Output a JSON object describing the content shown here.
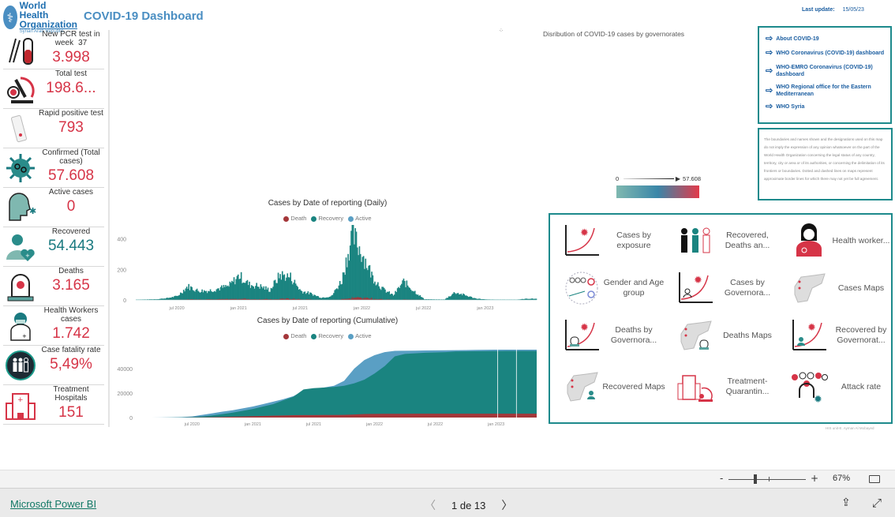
{
  "header": {
    "org_line1": "World Health",
    "org_line2": "Organization",
    "org_line3": "Syrian Arab Republic",
    "title": "COVID-19 Dashboard",
    "last_update_label": "Last update:",
    "last_update_value": "15/05/23"
  },
  "kpis": [
    {
      "label": "New PCR test in week",
      "sub": "37",
      "value": "3.998",
      "icon": "pcr-test-tube-icon",
      "color": "#d63447"
    },
    {
      "label": "Total test",
      "value": "198.6...",
      "icon": "microscope-icon",
      "color": "#d63447"
    },
    {
      "label": "Rapid positive test",
      "value": "793",
      "icon": "rapid-test-icon",
      "color": "#d63447"
    },
    {
      "label": "Confirmed (Total cases)",
      "value": "57.608",
      "icon": "virus-icon",
      "color": "#d63447"
    },
    {
      "label": "Active cases",
      "value": "0",
      "icon": "patient-head-icon",
      "color": "#d63447"
    },
    {
      "label": "Recovered",
      "value": "54.443",
      "icon": "recovered-person-heart-icon",
      "color": "#1a7a80"
    },
    {
      "label": "Deaths",
      "value": "3.165",
      "icon": "gravestone-icon",
      "color": "#d63447"
    },
    {
      "label": "Health Workers cases",
      "value": "1.742",
      "icon": "health-worker-icon",
      "color": "#d63447"
    },
    {
      "label": "Case fatality rate",
      "value": "5,49%",
      "icon": "people-circle-icon",
      "color": "#d63447"
    },
    {
      "label": "Treatment Hospitals",
      "value": "151",
      "icon": "hospital-icon",
      "color": "#d63447"
    }
  ],
  "map": {
    "title": "Disribution of COVID-19 cases by governorates",
    "scale_min": "0",
    "scale_max": "57.608",
    "gradient_colors": [
      "#7fb8b0",
      "#3a86a8",
      "#e23a4a"
    ]
  },
  "links": [
    "About COVID-19",
    "WHO Coronavirus (COVID-19) dashboard",
    "WHO-EMRO Coronavirus (COVID-19) dashboard",
    "WHO Regional office for the Eastern Mediterranean",
    "WHO Syria"
  ],
  "disclaimer": "The boundaries and names shown and the designations used on this map do not imply the expression of any opinion whatsoever on the part of the World Health Organization concerning the legal status of any country, territory, city or area or of its authorities, or concerning the delimitation of its frontiers or boundaries. Dotted and dashed lines on maps represent approximate border lines for which there may not yet be full agreement.",
  "nav_items": [
    {
      "label": "Cases by exposure",
      "icon": "chart-virus-icon"
    },
    {
      "label": "Recovered, Deaths an...",
      "icon": "three-people-icon"
    },
    {
      "label": "Health worker...",
      "icon": "doctor-woman-icon"
    },
    {
      "label": "Gender and Age group",
      "icon": "gender-age-icon"
    },
    {
      "label": "Cases by Governora...",
      "icon": "chart-person-virus-icon"
    },
    {
      "label": "Cases Maps",
      "icon": "syria-map-icon"
    },
    {
      "label": "Deaths by Governora...",
      "icon": "chart-gravestone-icon"
    },
    {
      "label": "Deaths Maps",
      "icon": "map-gravestone-icon"
    },
    {
      "label": "Recovered by Governorat...",
      "icon": "chart-recovered-icon"
    },
    {
      "label": "Recovered Maps",
      "icon": "map-recovered-icon"
    },
    {
      "label": "Treatment-Quarantin...",
      "icon": "hospital-microscope-icon"
    },
    {
      "label": "Attack rate",
      "icon": "people-virus-icon"
    }
  ],
  "credits": "HIS unit-E. Ayman Al Mobayed",
  "footer": {
    "zoom_minus": "-",
    "zoom_plus": "+",
    "zoom_level": "67%",
    "zoom_fraction": 0.35,
    "brand_link": "Microsoft Power BI",
    "page_indicator": "1 de 13"
  },
  "colors": {
    "death": "#a4373a",
    "recovery": "#1a8480",
    "active": "#5a9fc4",
    "teal_border": "#1d8a8c"
  },
  "chart_data": [
    {
      "type": "bar",
      "title": "Cases by Date of reporting (Daily)",
      "legend": [
        "Death",
        "Recovery",
        "Active"
      ],
      "legend_placement": "top-center",
      "xlabel": "",
      "ylabel": "",
      "x_ticks": [
        "jul 2020",
        "jan 2021",
        "jul 2021",
        "jan 2022",
        "jul 2022",
        "jan 2023"
      ],
      "y_ticks": [
        0,
        200,
        400
      ],
      "ylim": [
        0,
        450
      ],
      "x_months": [
        "2020-03",
        "2020-04",
        "2020-05",
        "2020-06",
        "2020-07",
        "2020-08",
        "2020-09",
        "2020-10",
        "2020-11",
        "2020-12",
        "2021-01",
        "2021-02",
        "2021-03",
        "2021-04",
        "2021-05",
        "2021-06",
        "2021-07",
        "2021-08",
        "2021-09",
        "2021-10",
        "2021-11",
        "2021-12",
        "2022-01",
        "2022-02",
        "2022-03",
        "2022-04",
        "2022-05",
        "2022-06",
        "2022-07",
        "2022-08",
        "2022-09",
        "2022-10",
        "2022-11",
        "2022-12",
        "2023-01",
        "2023-02",
        "2023-03",
        "2023-04",
        "2023-05"
      ],
      "series": [
        {
          "name": "Recovery",
          "values": [
            2,
            3,
            5,
            12,
            25,
            90,
            60,
            60,
            75,
            90,
            160,
            100,
            90,
            65,
            165,
            150,
            60,
            40,
            15,
            25,
            130,
            430,
            300,
            150,
            70,
            30,
            120,
            60,
            5,
            3,
            3,
            50,
            30,
            10,
            3,
            2,
            2,
            2,
            8
          ]
        },
        {
          "name": "Death",
          "values": [
            0,
            0,
            0,
            1,
            2,
            4,
            4,
            4,
            5,
            6,
            7,
            5,
            5,
            4,
            8,
            7,
            4,
            2,
            1,
            2,
            8,
            15,
            12,
            6,
            3,
            1,
            3,
            2,
            0,
            0,
            0,
            1,
            1,
            0,
            0,
            0,
            0,
            0,
            0
          ]
        },
        {
          "name": "Active",
          "values": [
            0,
            0,
            0,
            0,
            0,
            0,
            0,
            0,
            0,
            0,
            0,
            0,
            0,
            0,
            0,
            0,
            0,
            0,
            0,
            0,
            0,
            0,
            0,
            0,
            0,
            0,
            0,
            0,
            0,
            0,
            0,
            0,
            0,
            0,
            0,
            0,
            0,
            0,
            0
          ]
        }
      ]
    },
    {
      "type": "area",
      "title": "Cases by Date of reporting (Cumulative)",
      "legend": [
        "Death",
        "Recovery",
        "Active"
      ],
      "legend_placement": "top-center",
      "xlabel": "",
      "ylabel": "",
      "x_ticks": [
        "jul 2020",
        "jan 2021",
        "jul 2021",
        "jan 2022",
        "jul 2022",
        "jan 2023"
      ],
      "y_ticks": [
        0,
        20000,
        40000
      ],
      "ylim": [
        0,
        60000
      ],
      "x_months": [
        "2020-03",
        "2020-04",
        "2020-05",
        "2020-06",
        "2020-07",
        "2020-08",
        "2020-09",
        "2020-10",
        "2020-11",
        "2020-12",
        "2021-01",
        "2021-02",
        "2021-03",
        "2021-04",
        "2021-05",
        "2021-06",
        "2021-07",
        "2021-08",
        "2021-09",
        "2021-10",
        "2021-11",
        "2021-12",
        "2022-01",
        "2022-02",
        "2022-03",
        "2022-04",
        "2022-05",
        "2022-06",
        "2022-07",
        "2022-08",
        "2022-09",
        "2022-10",
        "2022-11",
        "2022-12",
        "2023-01",
        "2023-02",
        "2023-03",
        "2023-04",
        "2023-05"
      ],
      "series": [
        {
          "name": "Death",
          "values": [
            0,
            5,
            10,
            20,
            60,
            150,
            300,
            500,
            700,
            900,
            1100,
            1300,
            1500,
            1700,
            1900,
            2000,
            2050,
            2080,
            2100,
            2200,
            2500,
            2900,
            3000,
            3050,
            3080,
            3100,
            3110,
            3120,
            3130,
            3140,
            3145,
            3150,
            3155,
            3160,
            3162,
            3163,
            3164,
            3165,
            3165
          ]
        },
        {
          "name": "Recovery",
          "values": [
            0,
            20,
            60,
            150,
            400,
            900,
            1800,
            2800,
            4000,
            5500,
            7000,
            9000,
            11000,
            14000,
            17000,
            23000,
            24000,
            24500,
            25000,
            26000,
            28000,
            31000,
            36000,
            42000,
            50000,
            52000,
            52500,
            53000,
            53200,
            53500,
            54000,
            54100,
            54200,
            54300,
            54350,
            54400,
            54420,
            54440,
            54443
          ]
        },
        {
          "name": "Active",
          "values": [
            10,
            50,
            150,
            400,
            900,
            2200,
            3500,
            4800,
            6000,
            7500,
            9000,
            11000,
            13000,
            15000,
            17500,
            22000,
            23500,
            24500,
            26000,
            30000,
            40000,
            47000,
            51000,
            53500,
            54500,
            54600,
            54700,
            54800,
            54900,
            55000,
            55100,
            55200,
            55300,
            55400,
            55500,
            55500,
            55500,
            55500,
            55500
          ]
        }
      ]
    }
  ]
}
